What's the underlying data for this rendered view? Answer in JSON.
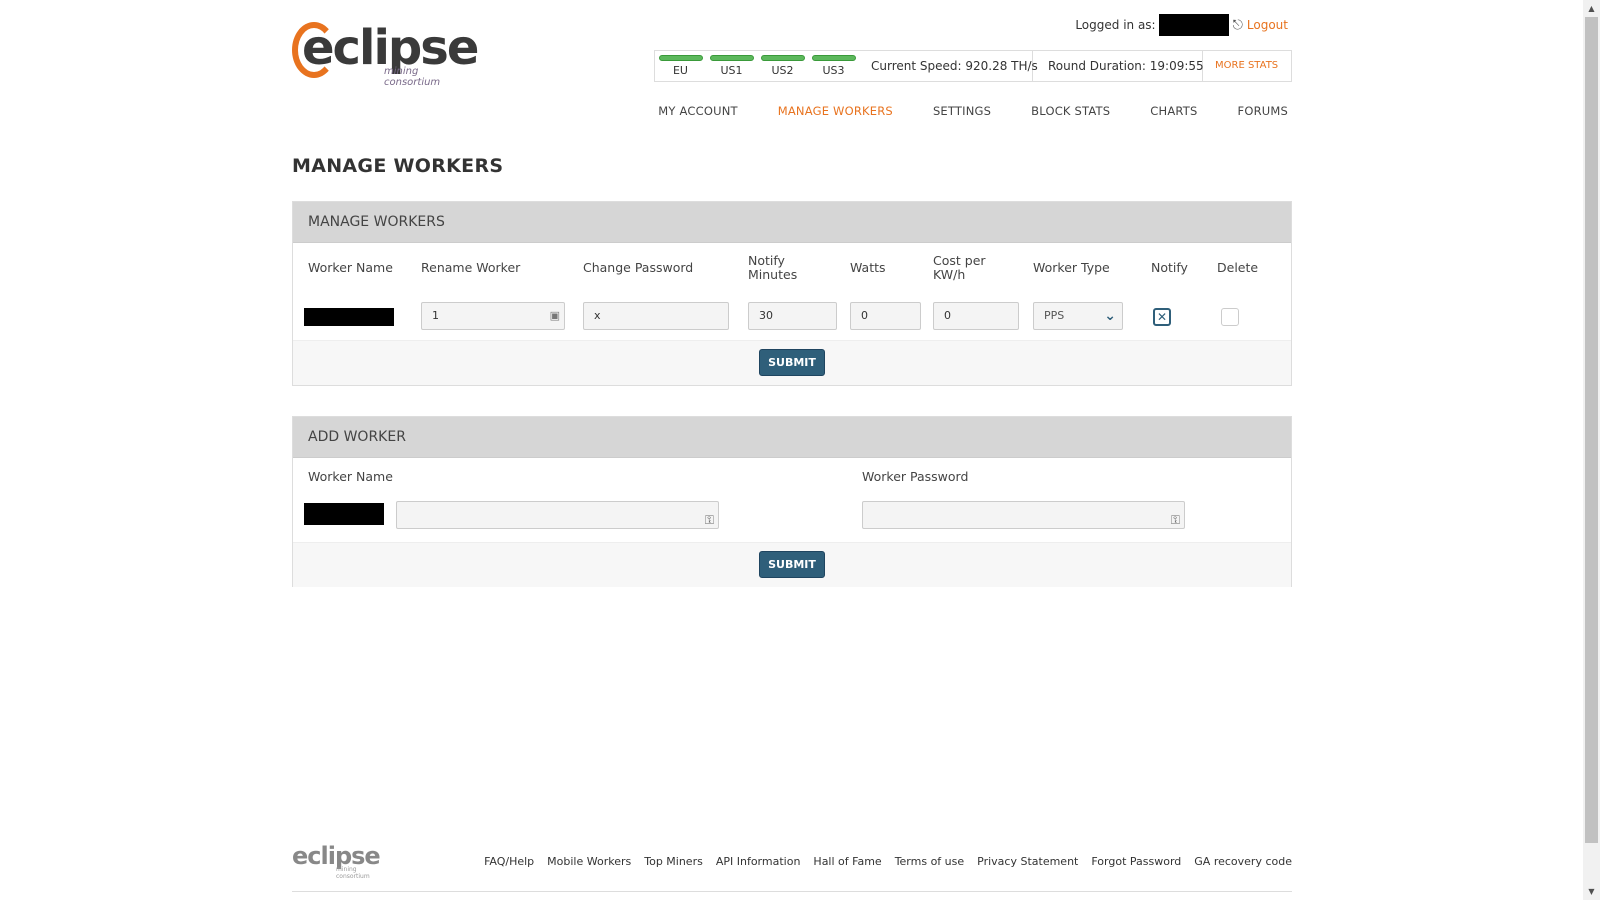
{
  "header": {
    "brand": "eclipse",
    "tagline": "mining consortium",
    "logged_in_label": "Logged in as:",
    "logout_label": "Logout"
  },
  "stats_bar": {
    "servers": [
      "EU",
      "US1",
      "US2",
      "US3"
    ],
    "current_speed": "Current Speed: 920.28 TH/s",
    "round_duration": "Round Duration: 19:09:55",
    "more_stats": "MORE STATS"
  },
  "nav": {
    "items": [
      "MY ACCOUNT",
      "MANAGE WORKERS",
      "SETTINGS",
      "BLOCK STATS",
      "CHARTS",
      "FORUMS"
    ],
    "active": "MANAGE WORKERS"
  },
  "page_title": "MANAGE WORKERS",
  "manage_panel": {
    "title": "MANAGE WORKERS",
    "columns": {
      "worker_name": "Worker Name",
      "rename_worker": "Rename Worker",
      "change_password": "Change Password",
      "notify_minutes": "Notify Minutes",
      "watts": "Watts",
      "cost_per_kwh": "Cost per KW/h",
      "worker_type": "Worker Type",
      "notify": "Notify",
      "delete": "Delete"
    },
    "row": {
      "rename_value": "1",
      "password_value": "x",
      "notify_minutes_value": "30",
      "watts_value": "0",
      "cost_value": "0",
      "worker_type_value": "PPS",
      "notify_checked": "✕"
    },
    "submit_label": "SUBMIT"
  },
  "add_panel": {
    "title": "ADD WORKER",
    "columns": {
      "worker_name": "Worker Name",
      "worker_password": "Worker Password"
    },
    "submit_label": "SUBMIT"
  },
  "footer": {
    "brand": "eclipse",
    "tagline": "mining consortium",
    "links": [
      "FAQ/Help",
      "Mobile Workers",
      "Top Miners",
      "API Information",
      "Hall of Fame",
      "Terms of use",
      "Privacy Statement",
      "Forgot Password",
      "GA recovery code"
    ]
  }
}
